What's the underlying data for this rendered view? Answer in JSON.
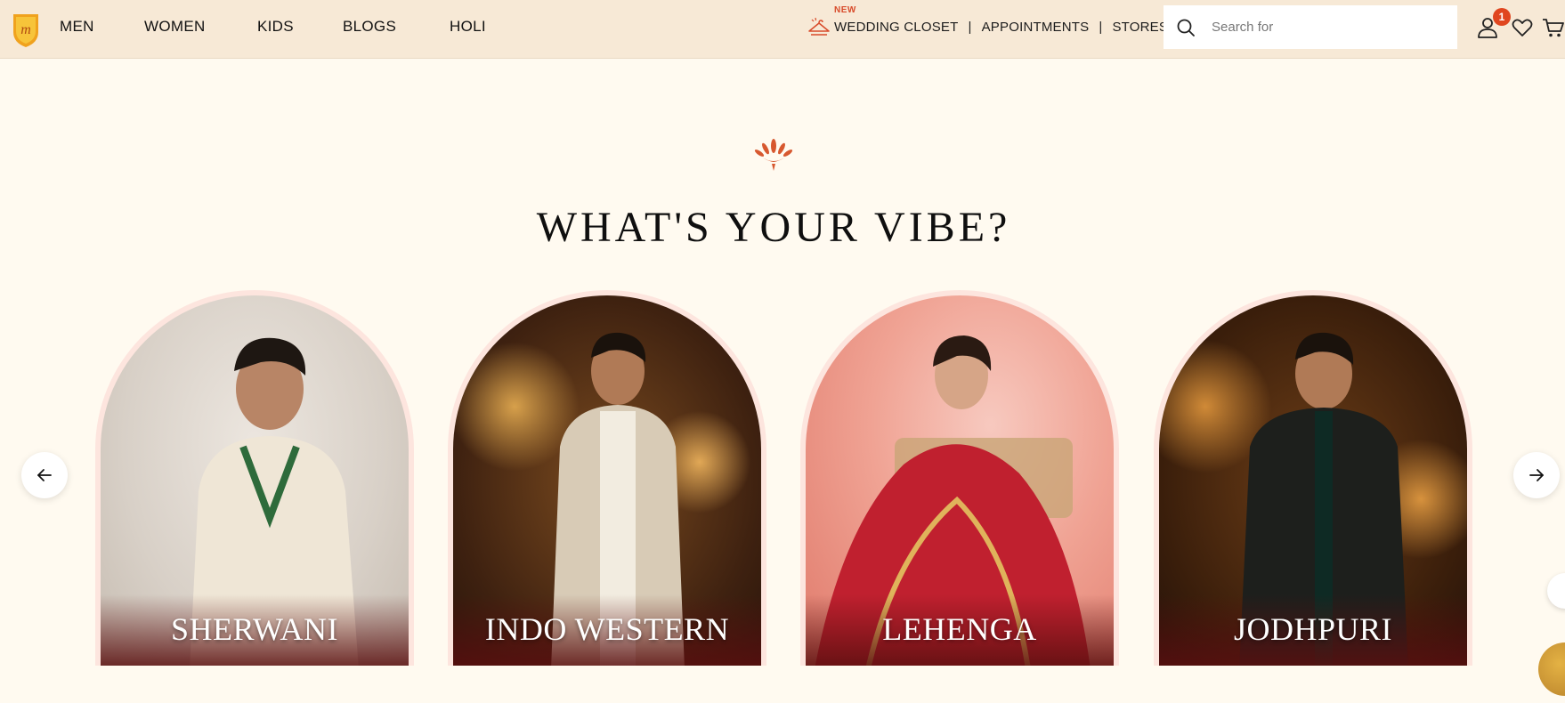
{
  "header": {
    "nav": [
      "MEN",
      "WOMEN",
      "KIDS",
      "BLOGS",
      "HOLI"
    ],
    "new_tag": "NEW",
    "wedding_closet": "WEDDING CLOSET",
    "appointments": "APPOINTMENTS",
    "stores": "STORES",
    "separator": "|",
    "search_placeholder": "Search for",
    "cart_count": "1",
    "icons": [
      "brand-logo",
      "hanger-icon",
      "search-icon",
      "user-icon",
      "heart-icon",
      "cart-icon"
    ]
  },
  "section": {
    "title": "WHAT'S YOUR VIBE?",
    "cards": [
      {
        "label": "SHERWANI"
      },
      {
        "label": "INDO WESTERN"
      },
      {
        "label": "LEHENGA"
      },
      {
        "label": "JODHPURI"
      }
    ],
    "prev_icon": "arrow-left-icon",
    "next_icon": "arrow-right-icon"
  },
  "colors": {
    "header_bg": "#f7e9d6",
    "page_bg": "#fffaf0",
    "accent": "#e0461f",
    "card_border": "#fde5de"
  }
}
